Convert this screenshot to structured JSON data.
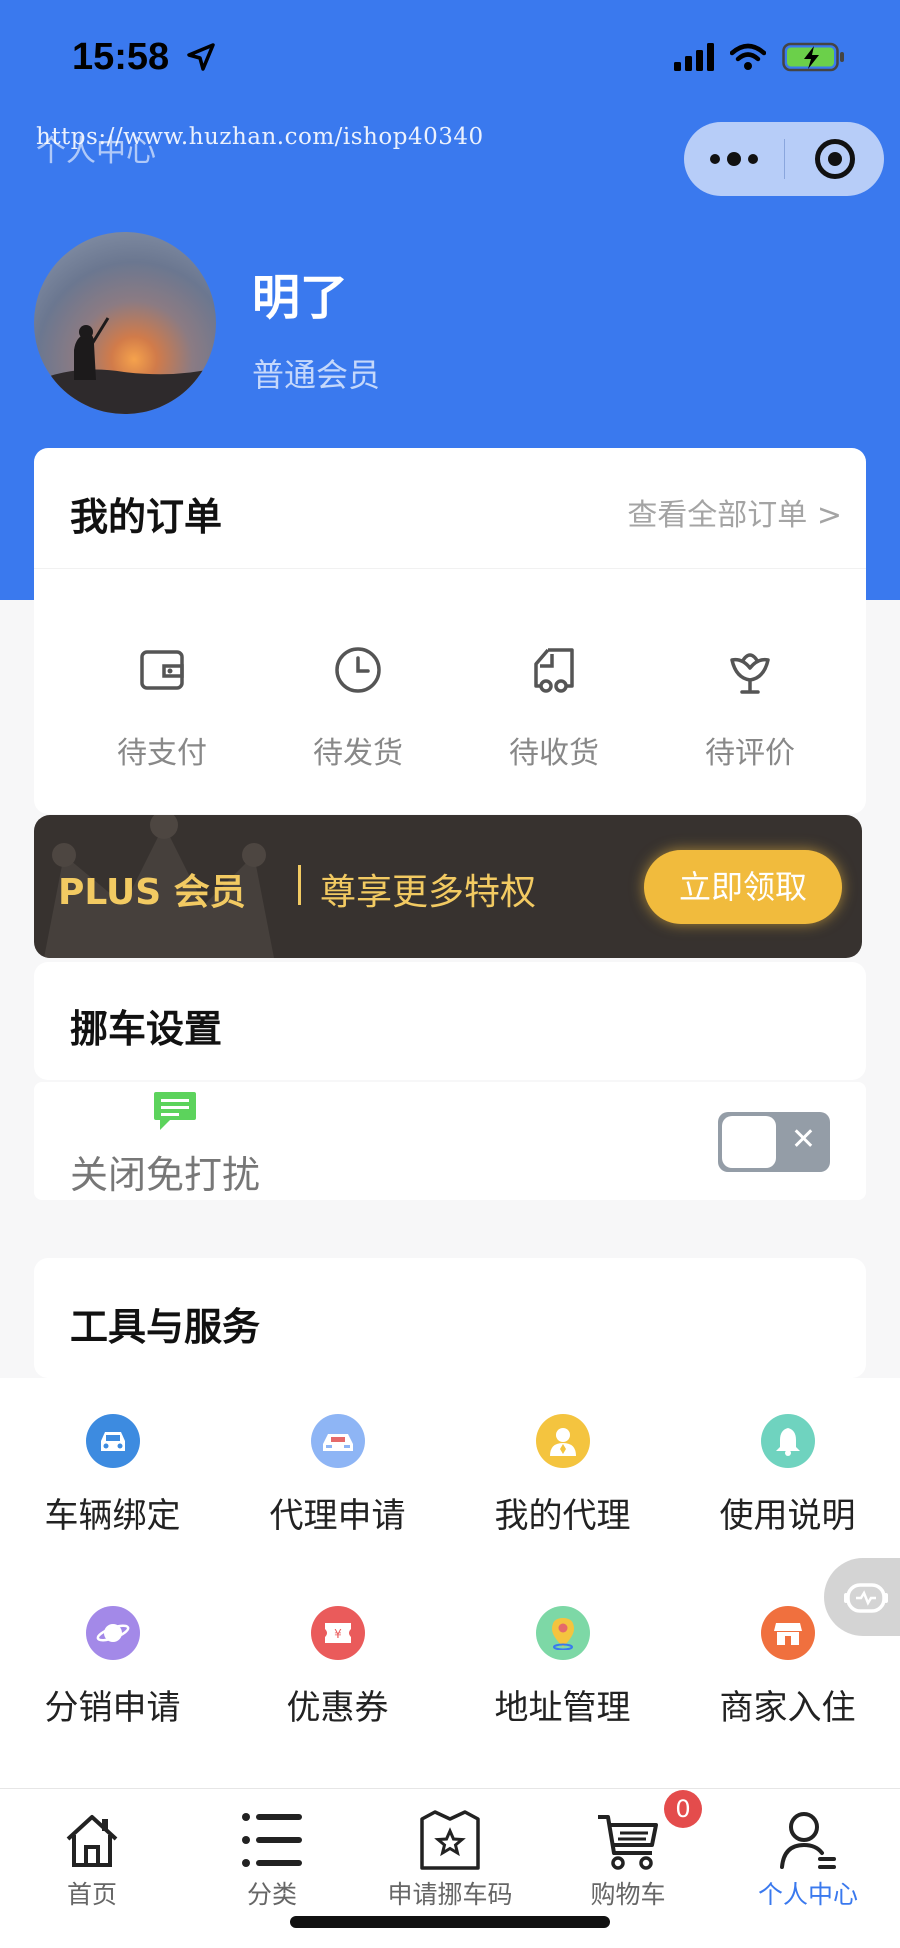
{
  "status_bar": {
    "time": "15:58"
  },
  "watermark": "https://www.huzhan.com/ishop40340",
  "nav": {
    "title": "个人中心"
  },
  "user": {
    "name": "明了",
    "level": "普通会员"
  },
  "orders": {
    "title": "我的订单",
    "view_all": "查看全部订单 >",
    "items": [
      {
        "label": "待支付",
        "icon": "wallet-icon"
      },
      {
        "label": "待发货",
        "icon": "clock-icon"
      },
      {
        "label": "待收货",
        "icon": "truck-icon"
      },
      {
        "label": "待评价",
        "icon": "flower-icon"
      }
    ]
  },
  "plus_banner": {
    "title": "PLUS 会员",
    "subtitle": "尊享更多特权",
    "button": "立即领取"
  },
  "move_car": {
    "title": "挪车设置",
    "dnd_label": "关闭免打扰",
    "dnd_enabled": false
  },
  "tools": {
    "title": "工具与服务",
    "items": [
      {
        "label": "车辆绑定",
        "icon": "car-icon",
        "color": "#3d8be0"
      },
      {
        "label": "代理申请",
        "icon": "car-front-icon",
        "color": "#8eb5f5"
      },
      {
        "label": "我的代理",
        "icon": "agent-icon",
        "color": "#f4c43f"
      },
      {
        "label": "使用说明",
        "icon": "bell-icon",
        "color": "#6fd3bf"
      },
      {
        "label": "分销申请",
        "icon": "planet-icon",
        "color": "#a389e8"
      },
      {
        "label": "优惠券",
        "icon": "coupon-icon",
        "color": "#ea5b5b"
      },
      {
        "label": "地址管理",
        "icon": "location-icon",
        "color": "#7dd8a6"
      },
      {
        "label": "商家入住",
        "icon": "store-icon",
        "color": "#f0703e"
      }
    ]
  },
  "tabbar": {
    "items": [
      {
        "label": "首页",
        "icon": "home-icon"
      },
      {
        "label": "分类",
        "icon": "list-icon"
      },
      {
        "label": "申请挪车码",
        "icon": "ticket-star-icon"
      },
      {
        "label": "购物车",
        "icon": "cart-icon",
        "badge": "0"
      },
      {
        "label": "个人中心",
        "icon": "user-icon",
        "active": true
      }
    ]
  },
  "colors": {
    "primary": "#3a79ee",
    "gold": "#f2ca62",
    "plus_button": "#f1bb3d"
  }
}
